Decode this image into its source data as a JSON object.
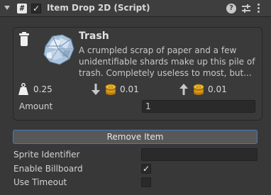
{
  "header": {
    "title": "Item Drop 2D (Script)",
    "script_icon": "#",
    "enabled_check": "✓",
    "help_glyph": "?"
  },
  "item": {
    "name": "Trash",
    "description_lines": [
      "A crumpled scrap of paper and a few",
      "unidentifiable shards make up this pile of",
      "trash. Completely useless to most, but..."
    ],
    "weight": "0.25",
    "sell_value": "0.01",
    "buy_value": "0.01"
  },
  "fields": {
    "amount_label": "Amount",
    "amount_value": "1"
  },
  "actions": {
    "remove_label": "Remove Item"
  },
  "properties": {
    "sprite_identifier_label": "Sprite Identifier",
    "sprite_identifier_value": "",
    "enable_billboard_label": "Enable Billboard",
    "enable_billboard_check": "✓",
    "use_timeout_label": "Use Timeout",
    "use_timeout_check": ""
  },
  "colors": {
    "background": "#383838",
    "accent_border": "#3f7bd0",
    "coin": "#e2a21a"
  }
}
